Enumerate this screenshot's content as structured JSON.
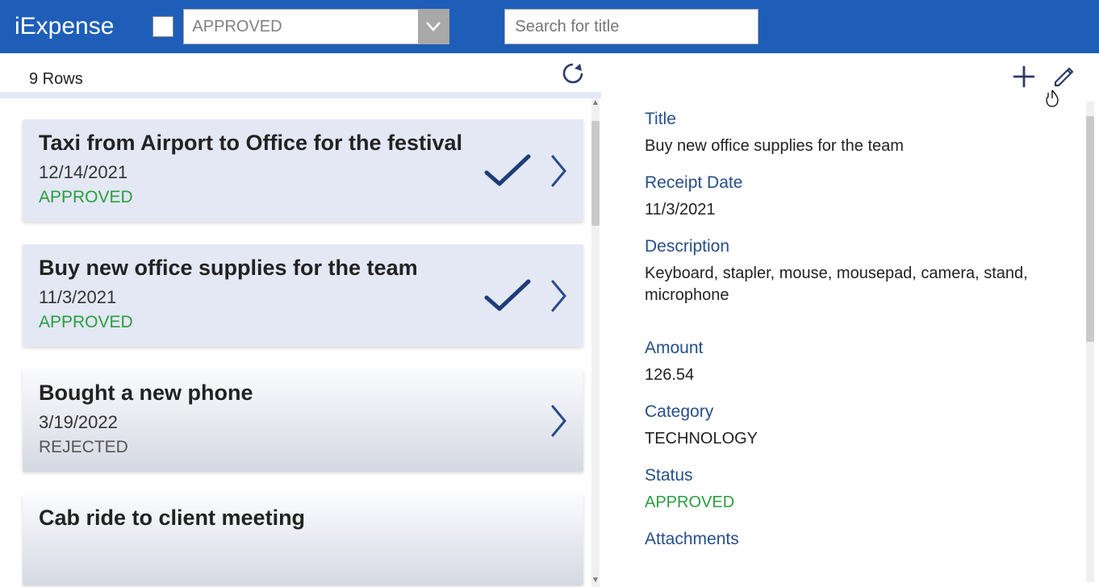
{
  "app": {
    "name": "iExpense"
  },
  "filters": {
    "checkbox_checked": false,
    "status_selected": "APPROVED",
    "search_placeholder": "Search for title"
  },
  "list": {
    "row_count_label": "9 Rows",
    "items": [
      {
        "title": "Taxi from Airport to Office for the festival",
        "date": "12/14/2021",
        "status": "APPROVED",
        "status_kind": "approved",
        "show_check": true
      },
      {
        "title": "Buy new office supplies for the team",
        "date": "11/3/2021",
        "status": "APPROVED",
        "status_kind": "approved",
        "show_check": true
      },
      {
        "title": "Bought a new phone",
        "date": "3/19/2022",
        "status": "REJECTED",
        "status_kind": "rejected",
        "show_check": false
      },
      {
        "title": "Cab ride to client meeting",
        "date": "",
        "status": "",
        "status_kind": "",
        "show_check": true
      }
    ]
  },
  "detail": {
    "labels": {
      "title": "Title",
      "receipt_date": "Receipt Date",
      "description": "Description",
      "amount": "Amount",
      "category": "Category",
      "status": "Status",
      "attachments": "Attachments"
    },
    "values": {
      "title": "Buy new office supplies for the team",
      "receipt_date": "11/3/2021",
      "description": "Keyboard, stapler, mouse, mousepad, camera, stand, microphone",
      "amount": "126.54",
      "category": "TECHNOLOGY",
      "status": "APPROVED"
    }
  },
  "colors": {
    "primary": "#1e5eb8",
    "approved": "#2a9d3f",
    "field_label": "#264e8a"
  }
}
